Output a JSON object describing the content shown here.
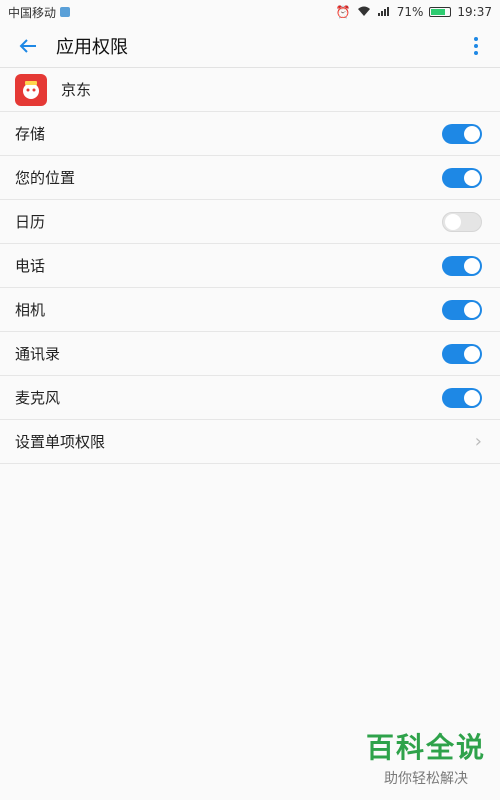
{
  "statusbar": {
    "carrier": "中国移动",
    "battery_percent": "71%",
    "time": "19:37",
    "icons": [
      "alarm-icon",
      "wifi-icon",
      "signal-icon",
      "battery-icon"
    ]
  },
  "header": {
    "title": "应用权限"
  },
  "app": {
    "name": "京东",
    "icon": "jd-app-icon"
  },
  "permissions": [
    {
      "label": "存储",
      "enabled": true
    },
    {
      "label": "您的位置",
      "enabled": true
    },
    {
      "label": "日历",
      "enabled": false
    },
    {
      "label": "电话",
      "enabled": true
    },
    {
      "label": "相机",
      "enabled": true
    },
    {
      "label": "通讯录",
      "enabled": true
    },
    {
      "label": "麦克风",
      "enabled": true
    }
  ],
  "single_permission_row": {
    "label": "设置单项权限"
  },
  "watermark": {
    "title": "百科全说",
    "subtitle": "助你轻松解决"
  },
  "colors": {
    "accent": "#1e88e5",
    "toggle_off": "#e5e5e5",
    "watermark_green": "#2ea24a"
  }
}
